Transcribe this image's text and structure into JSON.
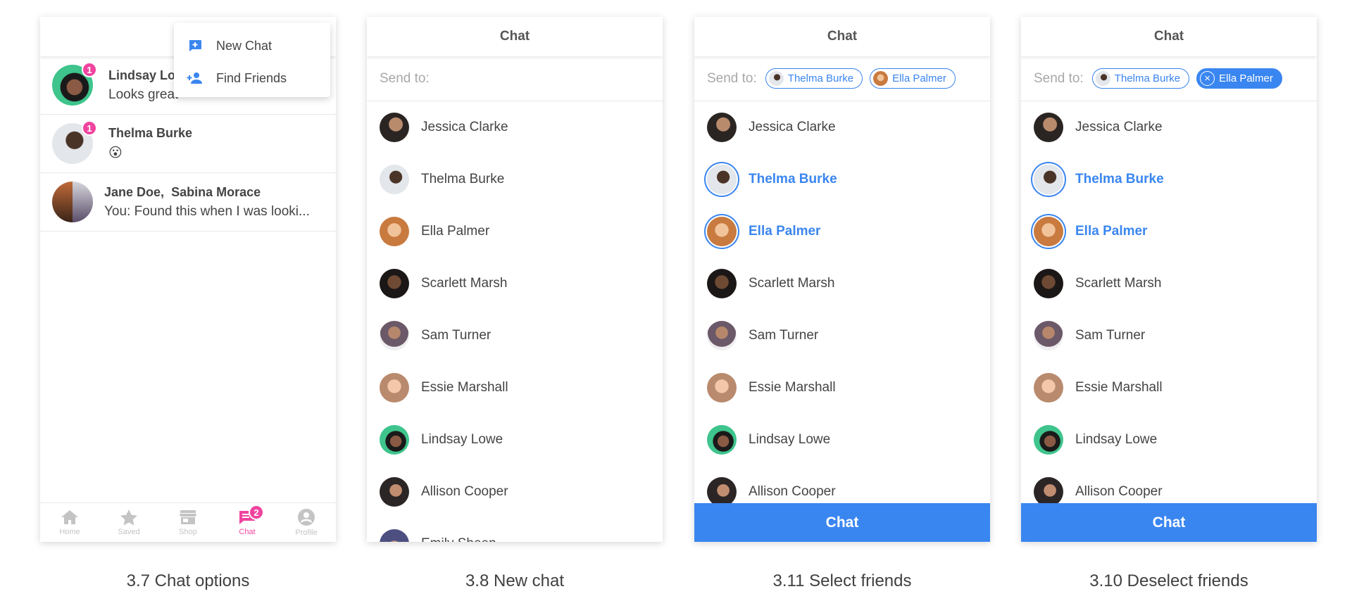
{
  "colors": {
    "accent_blue": "#3a86f0",
    "accent_pink": "#f0449f"
  },
  "screen1": {
    "caption": "3.7 Chat options",
    "dropdown": {
      "items": [
        {
          "label": "New Chat",
          "icon": "add-chat-icon"
        },
        {
          "label": "Find Friends",
          "icon": "add-person-icon"
        }
      ]
    },
    "conversations": [
      {
        "name": "Lindsay Lowe",
        "message": "Looks great",
        "badge": "1"
      },
      {
        "name": "Thelma Burke",
        "message": "😮",
        "badge": "1"
      },
      {
        "name_1": "Jane Doe,",
        "name_2": "Sabina Morace",
        "message": "You: Found this when I was looki..."
      }
    ],
    "tabs": [
      {
        "label": "Home",
        "icon": "home-icon"
      },
      {
        "label": "Saved",
        "icon": "star-icon"
      },
      {
        "label": "Shop",
        "icon": "shop-icon"
      },
      {
        "label": "Chat",
        "icon": "chat-icon",
        "badge": "2"
      },
      {
        "label": "Profile",
        "icon": "profile-icon"
      }
    ]
  },
  "screen2": {
    "caption": "3.8 New chat",
    "title": "Chat",
    "send_to_label": "Send to:",
    "contacts": [
      "Jessica Clarke",
      "Thelma Burke",
      "Ella Palmer",
      "Scarlett Marsh",
      "Sam Turner",
      "Essie Marshall",
      "Lindsay Lowe",
      "Allison Cooper",
      "Emily Sheen"
    ]
  },
  "screen3": {
    "caption": "3.11 Select friends",
    "title": "Chat",
    "send_to_label": "Send to:",
    "chips": [
      "Thelma Burke",
      "Ella Palmer"
    ],
    "contacts": [
      "Jessica Clarke",
      "Thelma Burke",
      "Ella Palmer",
      "Scarlett Marsh",
      "Sam Turner",
      "Essie Marshall",
      "Lindsay Lowe",
      "Allison Cooper"
    ],
    "button": "Chat"
  },
  "screen4": {
    "caption": "3.10 Deselect friends",
    "title": "Chat",
    "send_to_label": "Send to:",
    "chips": [
      "Thelma Burke",
      "Ella Palmer"
    ],
    "contacts": [
      "Jessica Clarke",
      "Thelma Burke",
      "Ella Palmer",
      "Scarlett Marsh",
      "Sam Turner",
      "Essie Marshall",
      "Lindsay Lowe",
      "Allison Cooper"
    ],
    "button": "Chat"
  }
}
